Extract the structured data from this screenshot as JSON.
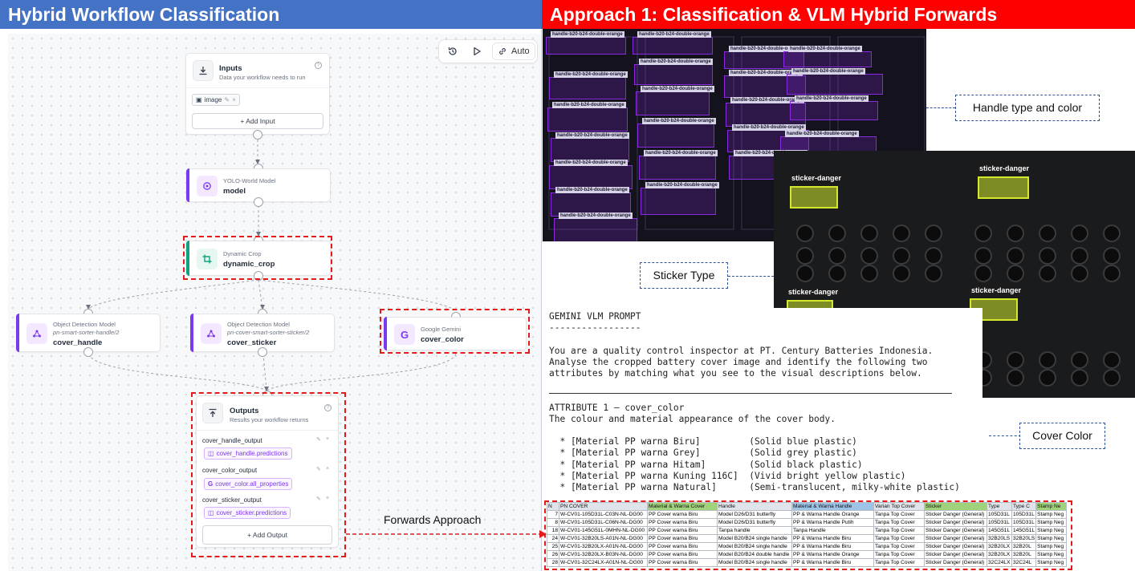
{
  "titles": {
    "left": "Hybrid Workflow Classification",
    "right": "Approach 1: Classification & VLM Hybrid Forwards"
  },
  "colors": {
    "left_title_bg": "#4472c4",
    "right_title_bg": "#ff0000",
    "highlight_dash": "#e31b1b",
    "node_accent": "#7c3aed",
    "crop_accent": "#10a37f",
    "handle_box": "#8a2be2",
    "sticker_box": "#d4e82b",
    "callout_border": "#2f5597"
  },
  "toolbar": {
    "auto_label": "Auto",
    "icons": [
      "history-icon",
      "play-icon",
      "link-icon"
    ]
  },
  "workflow": {
    "inputs_node": {
      "title": "Inputs",
      "subtitle": "Data your workflow needs to run",
      "input_chip": "image",
      "add_button": "+ Add Input"
    },
    "model_node": {
      "type": "YOLO-World Model",
      "name": "model"
    },
    "crop_node": {
      "type": "Dynamic Crop",
      "name": "dynamic_crop"
    },
    "handle_node": {
      "type": "Object Detection Model",
      "model_id": "pn-smart-sorter-handle/2",
      "name": "cover_handle"
    },
    "sticker_node": {
      "type": "Object Detection Model",
      "model_id": "pn-cover-smart-sorter-sticker/2",
      "name": "cover_sticker"
    },
    "gemini_node": {
      "type": "Google Gemini",
      "name": "cover_color"
    },
    "outputs_node": {
      "title": "Outputs",
      "subtitle": "Results your workflow returns",
      "outputs": [
        {
          "label": "cover_handle_output",
          "value": "cover_handle.predictions"
        },
        {
          "label": "cover_color_output",
          "value": "cover_color.all_properties"
        },
        {
          "label": "cover_sticker_output",
          "value": "cover_sticker.predictions"
        }
      ],
      "add_button": "+ Add Output"
    }
  },
  "forwards_label": "Forwards Approach",
  "handle_detection": {
    "label": "handle-b20-b24-double-orange",
    "detections": 22
  },
  "sticker_detection": {
    "label": "sticker-danger",
    "detections": 4
  },
  "callouts": {
    "handle": "Handle type and color",
    "sticker": "Sticker Type",
    "color": "Cover Color"
  },
  "prompt": {
    "lines": [
      "GEMINI VLM PROMPT",
      "-----------------",
      "",
      "You are a quality control inspector at PT. Century Batteries Indonesia.",
      "Analyse the cropped battery cover image and identify the following two",
      "attributes by matching what you see to the visual descriptions below.",
      "",
      "",
      "ATTRIBUTE 1 — cover_color",
      "The colour and material appearance of the cover body.",
      "",
      "  * [Material PP warna Biru]         (Solid blue plastic)",
      "  * [Material PP warna Grey]         (Solid grey plastic)",
      "  * [Material PP warna Hitam]        (Solid black plastic)",
      "  * [Material PP warna Kuning 116C]  (Vivid bright yellow plastic)",
      "  * [Material PP warna Natural]      (Semi-translucent, milky-white plastic)"
    ]
  },
  "table": {
    "headers": [
      "N",
      "PN COVER",
      "Material & Warna Cover",
      "Handle",
      "Material & Warna Handle",
      "Varian Top Cover",
      "Sticker",
      "Type",
      "Type C",
      "Stamp Ne"
    ],
    "header_colors": [
      "#dfe3ea",
      "#dfe3ea",
      "#9fd27a",
      "#dfe3ea",
      "#9dc3e6",
      "#dfe3ea",
      "#9fd27a",
      "#dfe3ea",
      "#dfe3ea",
      "#9fd27a"
    ],
    "rows": [
      [
        "7",
        "W-CV01-105D31L-C03N-NL-DG00",
        "PP Cover warna Biru",
        "Model D26/D31 butterfly",
        "PP & Warna Handle Orange",
        "Tanpa Top Cover",
        "Sticker Danger (General)",
        "105D31L",
        "105D31L",
        "Stamp Neg"
      ],
      [
        "8",
        "W-CV01-105D31L-C06N-NL-DG00",
        "PP Cover warna Biru",
        "Model D26/D31 butterfly",
        "PP & Warna Handle Putih",
        "Tanpa Top Cover",
        "Sticker Danger (General)",
        "105D31L",
        "105D31L",
        "Stamp Neg"
      ],
      [
        "18",
        "W-CV01-145G51L-0MHN-NL-DG00",
        "PP Cover warna Biru",
        "Tanpa handle",
        "Tanpa Handle",
        "Tanpa Top Cover",
        "Sticker Danger (General)",
        "145G51L",
        "145G51L",
        "Stamp Neg"
      ],
      [
        "24",
        "W-CV01-32B20LS-A01N-NL-DG00",
        "PP Cover warna Biru",
        "Model B20/B24 single handle",
        "PP & Warna Handle Biru",
        "Tanpa Top Cover",
        "Sticker Danger (General)",
        "32B20LS",
        "32B20LS",
        "Stamp Neg"
      ],
      [
        "25",
        "W-CV01-32B20LX-A01N-NL-DG00",
        "PP Cover warna Biru",
        "Model B20/B24 single handle",
        "PP & Warna Handle Biru",
        "Tanpa Top Cover",
        "Sticker Danger (General)",
        "32B20LX",
        "32B20L",
        "Stamp Neg"
      ],
      [
        "26",
        "W-CV01-32B20LX-B03N-NL-DG00",
        "PP Cover warna Biru",
        "Model B20/B24 double handle",
        "PP & Warna Handle Orange",
        "Tanpa Top Cover",
        "Sticker Danger (General)",
        "32B20LX",
        "32B20L",
        "Stamp Neg"
      ],
      [
        "28",
        "W-CV01-32C24LX-A01N-NL-DG00",
        "PP Cover warna Biru",
        "Model B20/B24 single handle",
        "PP & Warna Handle Biru",
        "Tanpa Top Cover",
        "Sticker Danger (General)",
        "32C24LX",
        "32C24L",
        "Stamp Neg"
      ]
    ]
  }
}
